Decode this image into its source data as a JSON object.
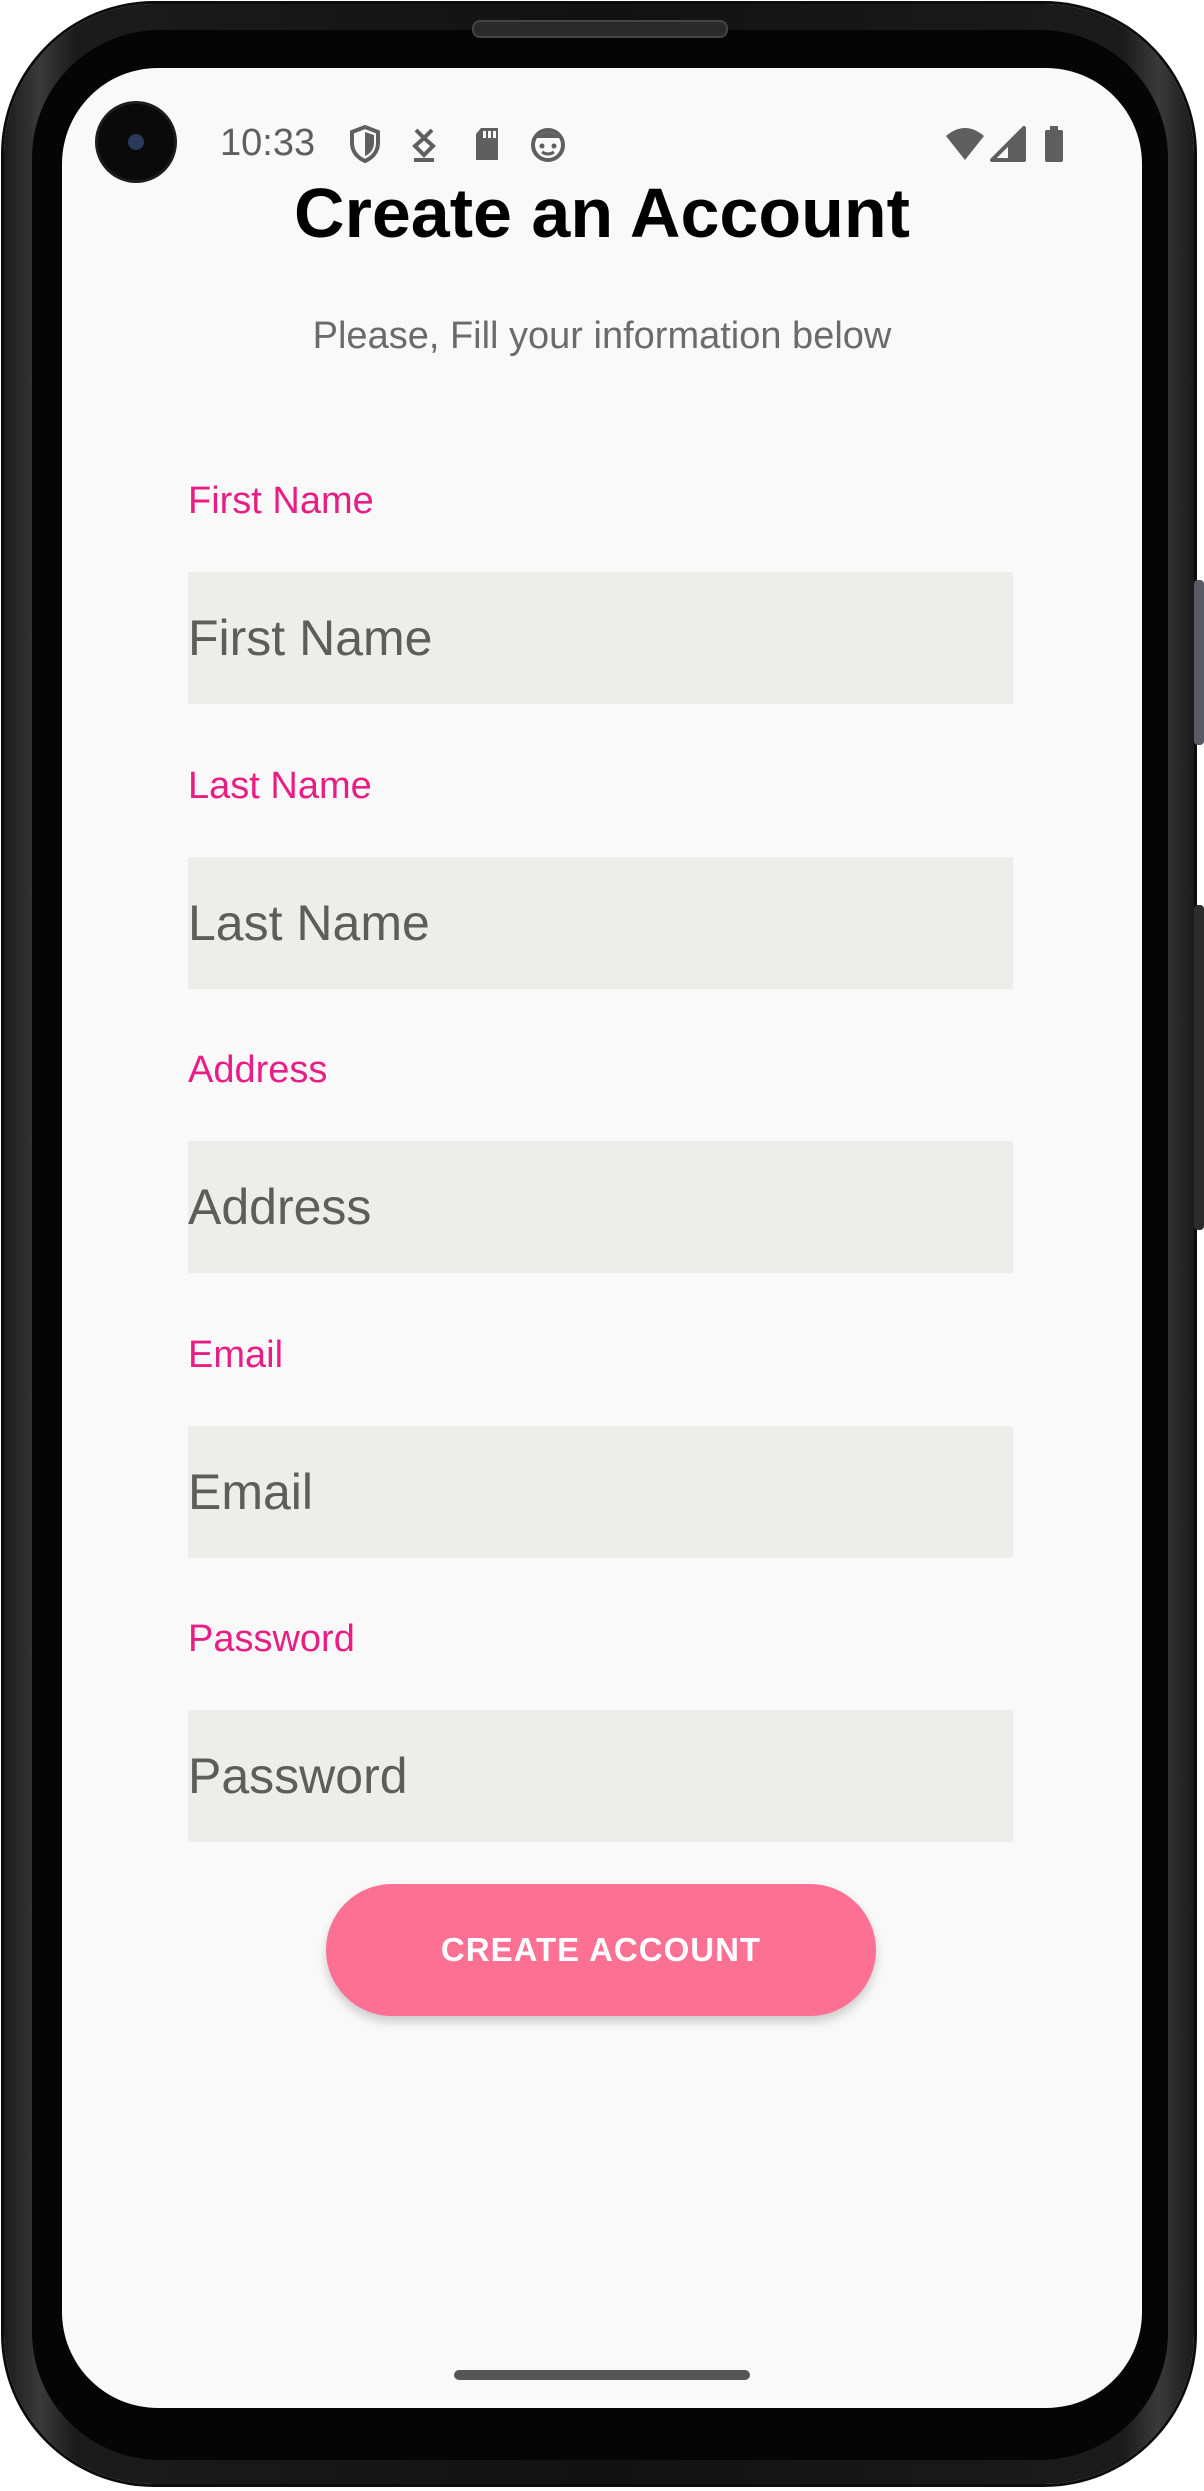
{
  "status_bar": {
    "time": "10:33",
    "left_icons": [
      "shield-icon",
      "download-arrow-icon",
      "sd-card-icon",
      "face-icon"
    ],
    "right_icons": [
      "wifi-icon",
      "cell-signal-icon",
      "battery-icon"
    ]
  },
  "header": {
    "title": "Create an Account",
    "subtitle": "Please, Fill your information below"
  },
  "form": {
    "fields": [
      {
        "label": "First Name",
        "placeholder": "First Name",
        "value": ""
      },
      {
        "label": "Last Name",
        "placeholder": "Last Name",
        "value": ""
      },
      {
        "label": "Address",
        "placeholder": "Address",
        "value": ""
      },
      {
        "label": "Email",
        "placeholder": "Email",
        "value": ""
      },
      {
        "label": "Password",
        "placeholder": "Password",
        "value": ""
      }
    ],
    "submit_label": "CREATE ACCOUNT"
  },
  "colors": {
    "label": "#e91e84",
    "input_background": "#ededea",
    "button": "#fc7094",
    "screen_background": "#f9f9f9"
  }
}
